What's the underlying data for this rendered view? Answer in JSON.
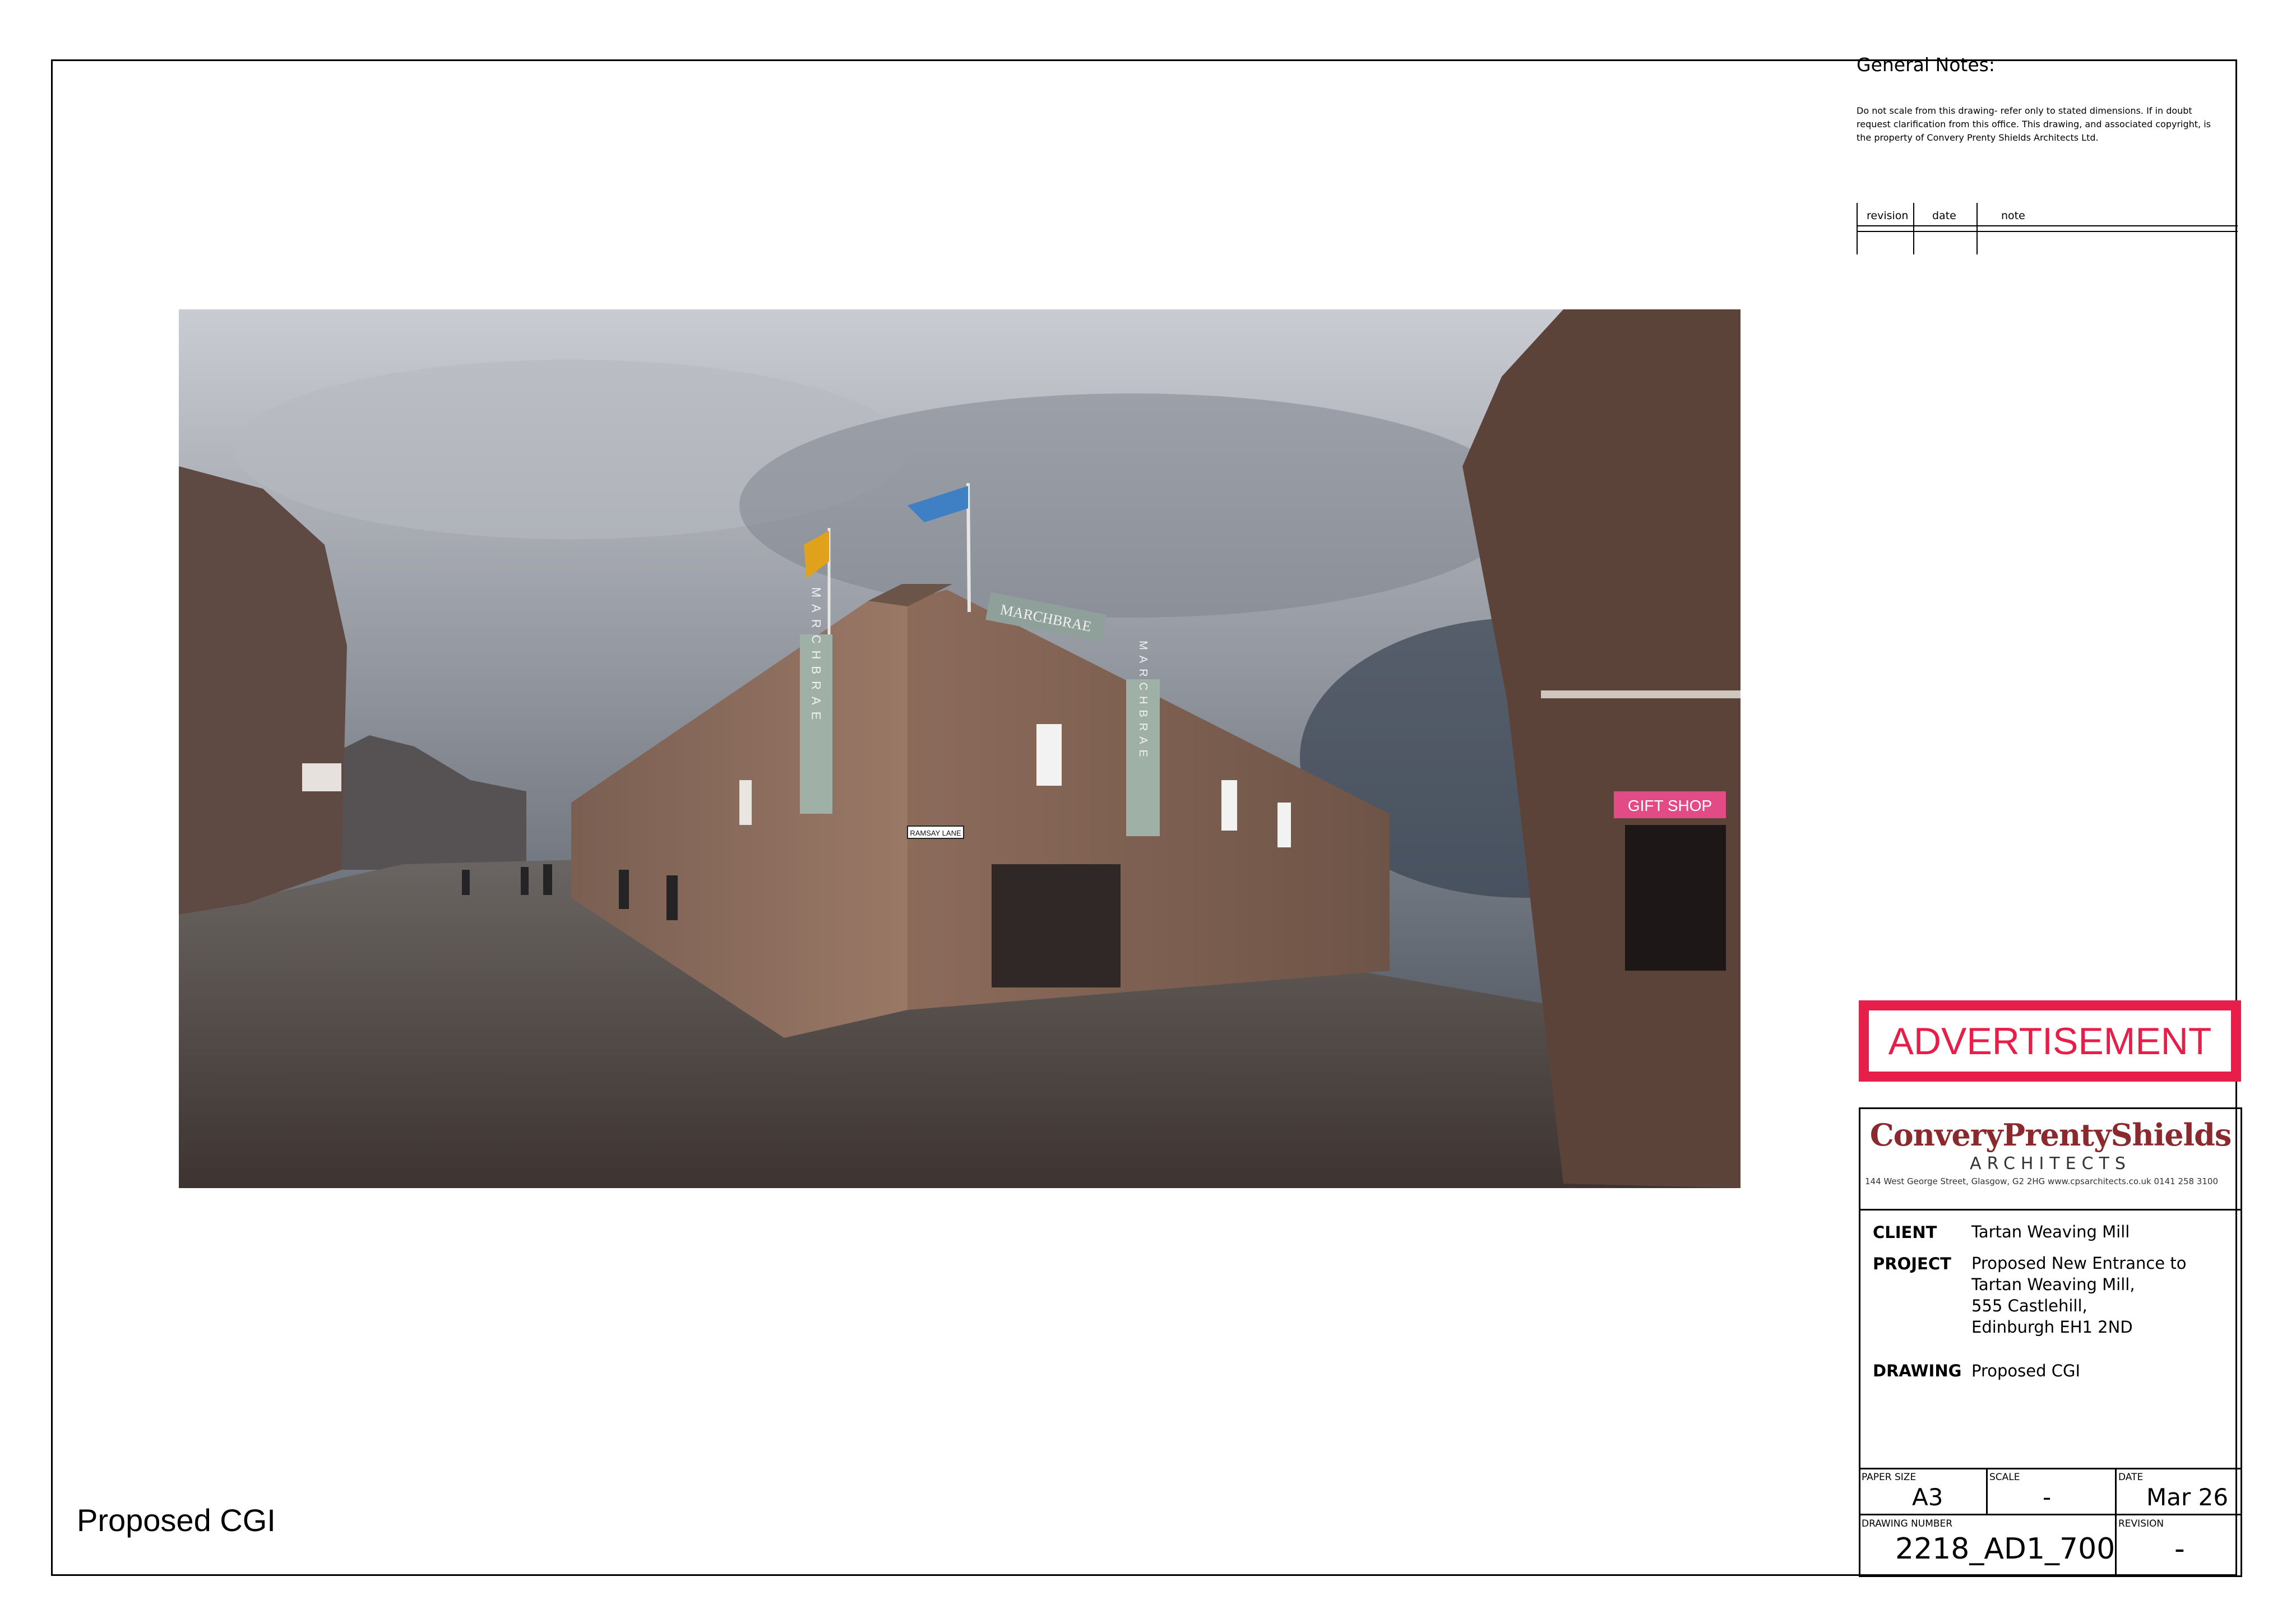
{
  "notes": {
    "heading": "General Notes:",
    "text": "Do not scale from this drawing- refer only to stated dimensions. If in doubt request clarification from this office. This drawing, and associated copyright, is the property of Convery Prenty Shields Architects Ltd."
  },
  "revision_table": {
    "headers": [
      "revision",
      "date",
      "note"
    ]
  },
  "photo": {
    "fascia_sign": "MARCHBRAE",
    "banner_left": "MARCHBRAE",
    "banner_right": "MARCHBRAE",
    "street_sign": "RAMSAY LANE",
    "shop_sign": "GIFT SHOP"
  },
  "advertisement": {
    "label": "ADVERTISEMENT",
    "color": "#e81e4a"
  },
  "title_block": {
    "logo": {
      "name": "ConveryPrentyShields",
      "subtitle": "ARCHITECTS",
      "address": "144 West George Street, Glasgow, G2 2HG  www.cpsarchitects.co.uk  0141 258 3100",
      "color": "#8b2a2e"
    },
    "client_label": "CLIENT",
    "client": "Tartan Weaving Mill",
    "project_label": "PROJECT",
    "project_lines": [
      "Proposed New Entrance to",
      "Tartan Weaving Mill,",
      "555 Castlehill,",
      "Edinburgh EH1 2ND"
    ],
    "drawing_label": "DRAWING",
    "drawing": "Proposed CGI",
    "paper_size_label": "PAPER SIZE",
    "paper_size": "A3",
    "scale_label": "SCALE",
    "scale": "-",
    "date_label": "DATE",
    "date": "Mar 26",
    "drawing_number_label": "DRAWING NUMBER",
    "drawing_number": "2218_AD1_700",
    "revision_label": "REVISION",
    "revision": "-"
  },
  "sheet_title": "Proposed CGI"
}
